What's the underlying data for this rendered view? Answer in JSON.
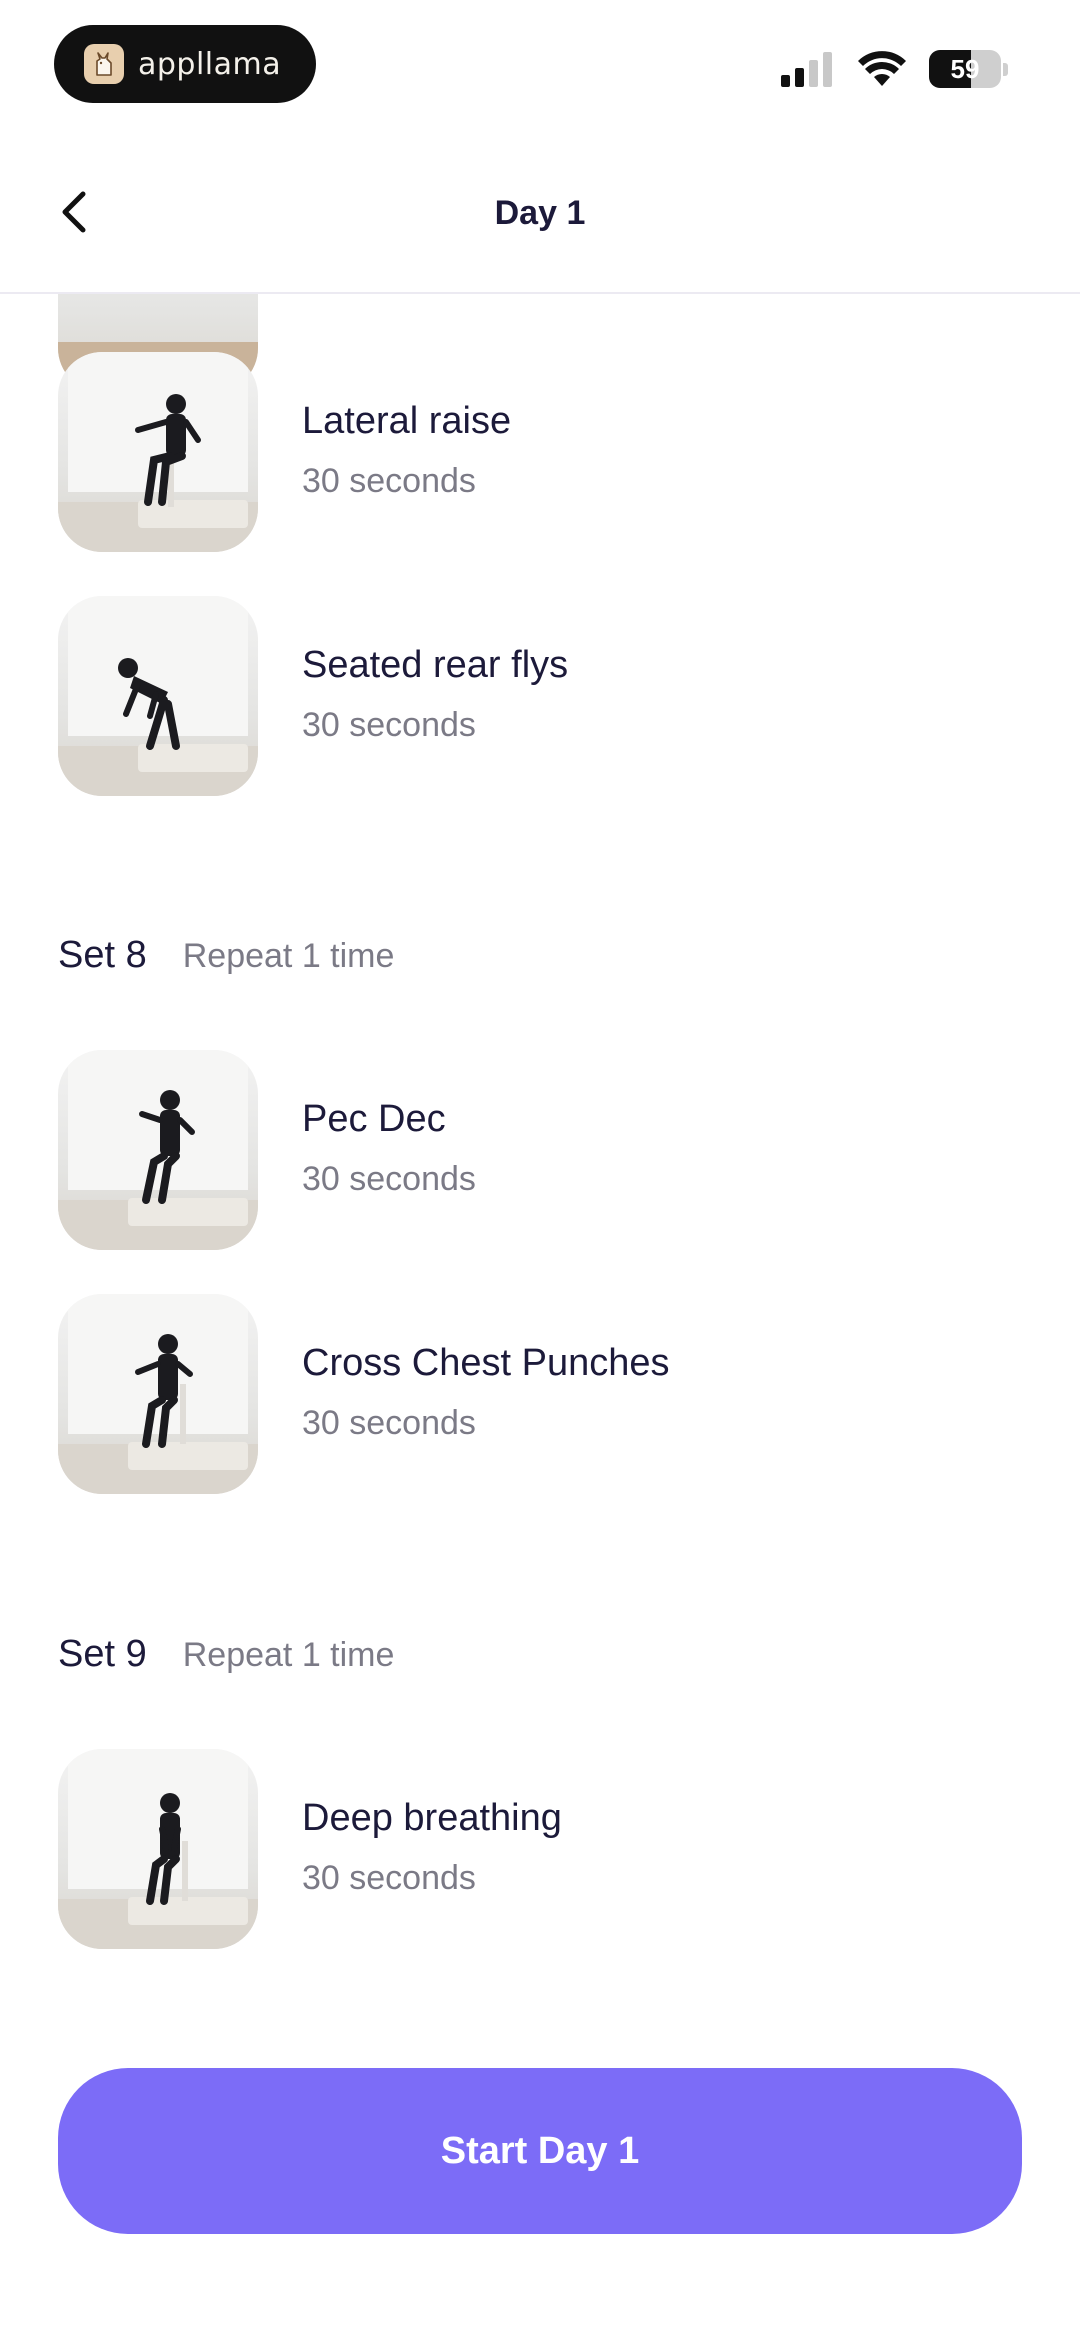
{
  "status_bar": {
    "brand_name": "appllama",
    "battery_level": "59",
    "battery_fraction": 0.59,
    "signal_icon": "signal-bars-icon",
    "wifi_icon": "wifi-icon"
  },
  "nav": {
    "title": "Day 1",
    "back_icon": "chevron-left-icon"
  },
  "sections": [
    {
      "exercises": [
        {
          "name": "Lateral raise",
          "duration": "30 seconds"
        },
        {
          "name": "Seated rear flys",
          "duration": "30 seconds"
        }
      ]
    },
    {
      "title": "Set 8",
      "repeat": "Repeat 1 time",
      "exercises": [
        {
          "name": "Pec Dec",
          "duration": "30 seconds"
        },
        {
          "name": "Cross Chest Punches",
          "duration": "30 seconds"
        }
      ]
    },
    {
      "title": "Set 9",
      "repeat": "Repeat 1 time",
      "exercises": [
        {
          "name": "Deep breathing",
          "duration": "30 seconds"
        }
      ]
    }
  ],
  "start_button": {
    "label": "Start Day 1"
  },
  "colors": {
    "accent": "#7c6cf7",
    "text_primary": "#1c1a3a",
    "text_secondary": "#7b7a86"
  }
}
